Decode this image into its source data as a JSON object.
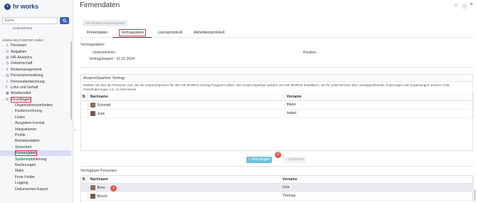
{
  "app": {
    "logo_text": "hr works"
  },
  "search": {
    "placeholder": "Suche"
  },
  "sidebar": {
    "top_cut_label": "Unternehmen",
    "org_label": "ADMIN HELPCENTER GMBH",
    "items": [
      {
        "label": "Personen",
        "icon": "users-icon",
        "chev": "›"
      },
      {
        "label": "Aufgaben",
        "icon": "tasks-icon",
        "chev": "›"
      },
      {
        "label": "HR-Analytics",
        "icon": "analytics-icon",
        "chev": ""
      },
      {
        "label": "Zeitwirtschaft",
        "icon": "clock-icon",
        "chev": "›"
      },
      {
        "label": "Reisemanagement",
        "icon": "travel-icon",
        "chev": "›"
      },
      {
        "label": "Personalverwaltung",
        "icon": "folder-icon",
        "chev": "›"
      },
      {
        "label": "Personalentwicklung",
        "icon": "growth-icon",
        "chev": "›"
      },
      {
        "label": "Lohn und Gehalt",
        "icon": "payroll-icon",
        "chev": "›"
      },
      {
        "label": "Arbeitsmittel",
        "icon": "tools-icon",
        "chev": "›"
      },
      {
        "label": "Grundlagen",
        "icon": "settings-icon",
        "chev": "⌄"
      }
    ],
    "subitems": [
      {
        "label": "Organisationseinheiten",
        "chev": ""
      },
      {
        "label": "Kostenrechnung",
        "chev": "›"
      },
      {
        "label": "Listen",
        "chev": "›"
      },
      {
        "label": "Ausgaben-Format",
        "chev": "›"
      },
      {
        "label": "Integrationen",
        "chev": "›"
      },
      {
        "label": "Profile",
        "chev": "›"
      },
      {
        "label": "Betriebsstätten",
        "chev": ""
      },
      {
        "label": "Sicherheit",
        "chev": "›"
      },
      {
        "label": "Firmendaten",
        "chev": ""
      },
      {
        "label": "Systemoptimierung",
        "chev": ""
      },
      {
        "label": "Rechnungen",
        "chev": ""
      },
      {
        "label": "Mails",
        "chev": ""
      },
      {
        "label": "Freie Felder",
        "chev": ""
      },
      {
        "label": "Logging",
        "chev": ""
      },
      {
        "label": "Dokumenten-Export",
        "chev": ""
      }
    ]
  },
  "header": {
    "title": "Firmendaten",
    "portal_button": "HR WORKS-Kundencenter",
    "tabs": [
      "Firmendaten",
      "Vertragsdaten",
      "Lizenzprotokoll",
      "Aktivitätenprotokoll"
    ]
  },
  "contract": {
    "section_title": "Vertragsdaten",
    "signatory_label": "Unterzeichner :",
    "position_label": "Position :",
    "start_label": "Vertragsbeginn :",
    "start_value": "01.01.2024"
  },
  "contacts": {
    "title": "Ansprechpartner Vertrag",
    "info": "Wählen Sie hier die Personen aus, die als Ansprechpartner für den HR WORKS-Vertrag fungieren sollen. Die Ansprechpartner werden von HR WORKS kontaktiert, um Ihr Unternehmen über vertragsrelevante Änderungen wie Anpassungen unserer AGB, Preisänderungen o.ä. zu informieren.",
    "col_b": "B.",
    "col_last": "Nachname",
    "col_first": "Vorname",
    "rows": [
      {
        "last": "Schmidt",
        "first": "Marie"
      },
      {
        "last": "Juric",
        "first": "Isabel"
      }
    ]
  },
  "actions": {
    "add": "Hinzufügen",
    "remove": "Entfernen",
    "add_badge": "2"
  },
  "available": {
    "title": "Verfügbare Personen",
    "col_b": "B.",
    "col_last": "Nachname",
    "col_first": "Vorname",
    "badge": "1",
    "rows": [
      {
        "last": "Born",
        "first": "Lina"
      },
      {
        "last": "Bösch",
        "first": "Thomas"
      }
    ]
  }
}
